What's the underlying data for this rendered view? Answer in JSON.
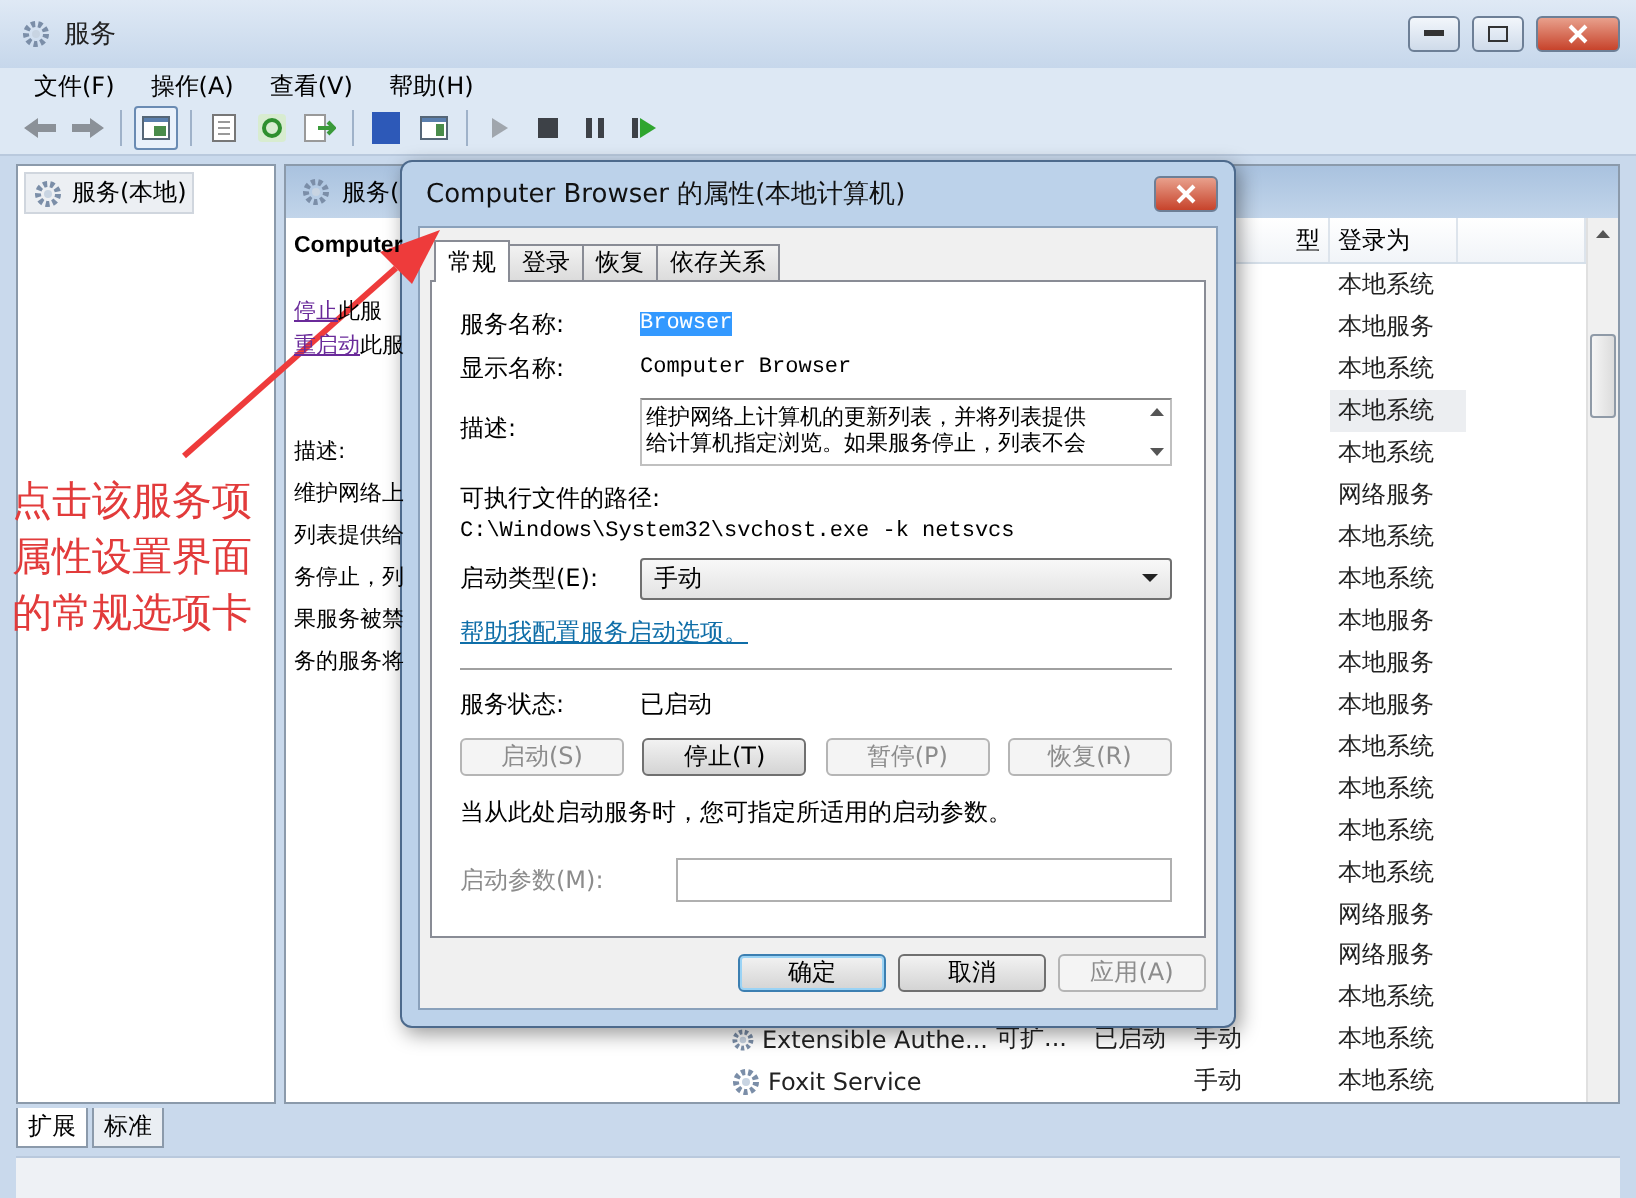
{
  "window": {
    "title": "服务"
  },
  "menu": [
    "文件(F)",
    "操作(A)",
    "查看(V)",
    "帮助(H)"
  ],
  "tree": {
    "items": [
      {
        "label": "服务(本地)",
        "selected": true
      }
    ]
  },
  "panel": {
    "header": "服务(",
    "details": {
      "title": "Computer",
      "actions": [
        {
          "link": "停止",
          "text": "此服"
        },
        {
          "link": "重启动",
          "text": "此服"
        }
      ],
      "description_label": "描述:",
      "description_lines": [
        "维护网络上",
        "列表提供给",
        "务停止，列",
        "果服务被禁",
        "务的服务将"
      ]
    },
    "list": {
      "columns": [
        "型",
        "登录为"
      ],
      "rows": [
        {
          "logon": "本地系统",
          "selected": false
        },
        {
          "logon": "本地服务",
          "selected": false
        },
        {
          "logon": "本地系统",
          "selected": false
        },
        {
          "logon": "本地系统",
          "selected": true
        },
        {
          "logon": "本地系统",
          "selected": false
        },
        {
          "logon": "网络服务",
          "selected": false
        },
        {
          "logon": "本地系统",
          "selected": false
        },
        {
          "logon": "本地系统",
          "selected": false
        },
        {
          "logon": "本地服务",
          "selected": false
        },
        {
          "logon": "本地服务",
          "selected": false
        },
        {
          "logon": "本地服务",
          "selected": false
        },
        {
          "logon": "本地系统",
          "selected": false
        },
        {
          "logon": "本地系统",
          "selected": false
        },
        {
          "logon": "本地系统",
          "selected": false
        },
        {
          "logon": "本地系统",
          "selected": false
        },
        {
          "logon": "网络服务",
          "selected": false
        },
        {
          "logon": "网络服务",
          "selected": false
        },
        {
          "logon": "本地系统",
          "selected": false
        },
        {
          "name": "Extensible Authe...",
          "description": "可扩...",
          "status": "已启动",
          "startup": "手动",
          "logon": "本地系统",
          "selected": false
        },
        {
          "name": "Foxit Service",
          "startup": "手动",
          "logon": "本地系统",
          "selected": false
        }
      ]
    }
  },
  "bottom_tabs": [
    {
      "label": "扩展",
      "selected": true
    },
    {
      "label": "标准",
      "selected": false
    }
  ],
  "dialog": {
    "title": "Computer Browser 的属性(本地计算机)",
    "tabs": [
      {
        "label": "常规",
        "selected": true
      },
      {
        "label": "登录",
        "selected": false
      },
      {
        "label": "恢复",
        "selected": false
      },
      {
        "label": "依存关系",
        "selected": false
      }
    ],
    "service_name": {
      "label": "服务名称:",
      "value": "Browser"
    },
    "display_name": {
      "label": "显示名称:",
      "value": "Computer Browser"
    },
    "description": {
      "label": "描述:",
      "lines": [
        "维护网络上计算机的更新列表，并将列表提供",
        "给计算机指定浏览。如果服务停止，列表不会"
      ]
    },
    "path": {
      "label": "可执行文件的路径:",
      "value": "C:\\Windows\\System32\\svchost.exe -k netsvcs"
    },
    "startup_type": {
      "label": "启动类型(E):",
      "value": "手动"
    },
    "help_link": "帮助我配置服务启动选项。",
    "status": {
      "label": "服务状态:",
      "value": "已启动"
    },
    "control_buttons": [
      {
        "label": "启动(S)",
        "disabled": true
      },
      {
        "label": "停止(T)",
        "disabled": false
      },
      {
        "label": "暂停(P)",
        "disabled": true
      },
      {
        "label": "恢复(R)",
        "disabled": true
      }
    ],
    "hint": "当从此处启动服务时，您可指定所适用的启动参数。",
    "start_params": {
      "label": "启动参数(M):",
      "disabled": true
    },
    "footer_buttons": [
      {
        "label": "确定",
        "default": true,
        "disabled": false
      },
      {
        "label": "取消",
        "default": false,
        "disabled": false
      },
      {
        "label": "应用(A)",
        "default": false,
        "disabled": true
      }
    ]
  },
  "annotation": {
    "lines": [
      "点击该服务项",
      "属性设置界面",
      "的常规选项卡"
    ]
  }
}
